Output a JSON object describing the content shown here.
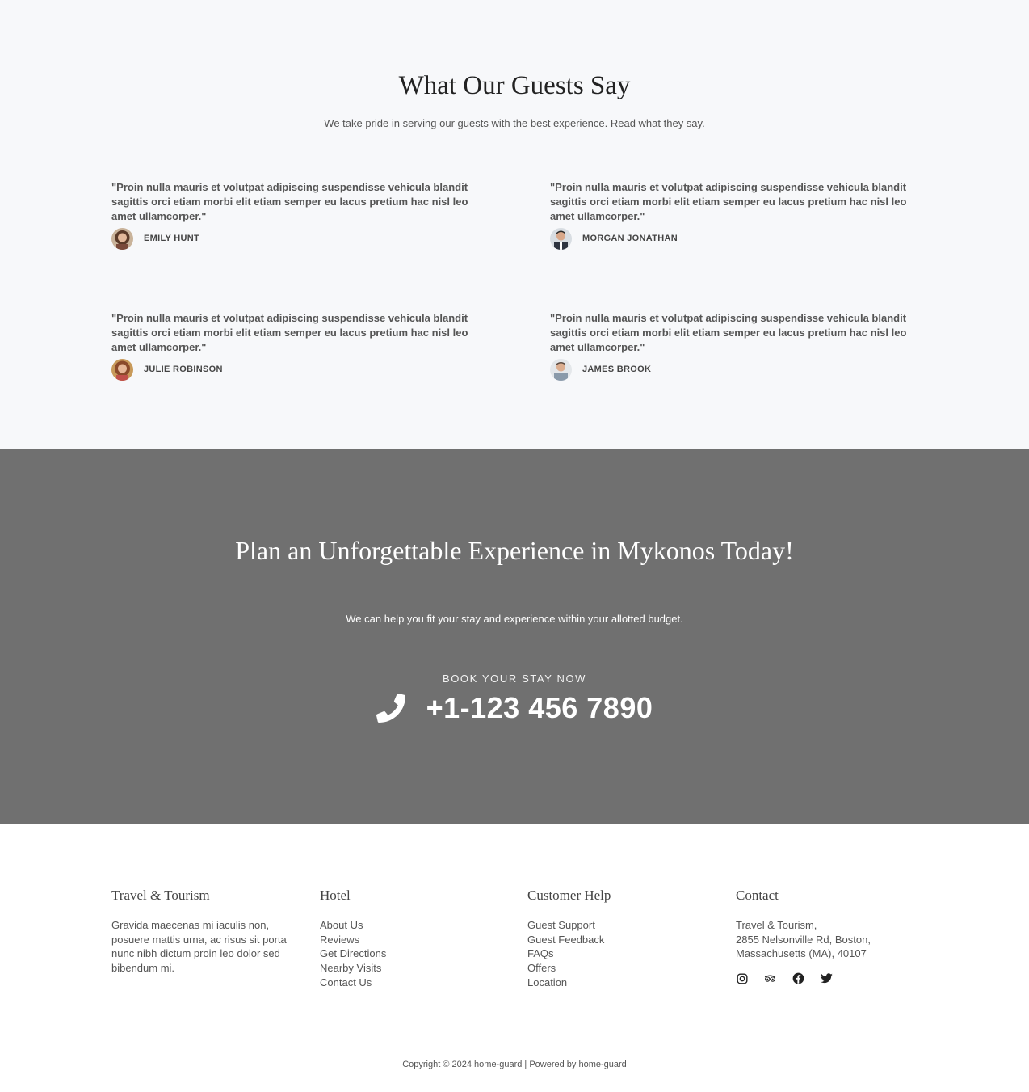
{
  "testimonials": {
    "heading": "What Our Guests Say",
    "subheading": "We take pride in serving our guests with the best experience. Read what they say.",
    "items": [
      {
        "quote": "\"Proin nulla mauris et volutpat adipiscing suspendisse vehicula blandit sagittis orci etiam morbi elit etiam semper eu lacus pretium hac nisl leo amet ullamcorper.\"",
        "name": "EMILY HUNT"
      },
      {
        "quote": "\"Proin nulla mauris et volutpat adipiscing suspendisse vehicula blandit sagittis orci etiam morbi elit etiam semper eu lacus pretium hac nisl leo amet ullamcorper.\"",
        "name": "MORGAN JONATHAN"
      },
      {
        "quote": "\"Proin nulla mauris et volutpat adipiscing suspendisse vehicula blandit sagittis orci etiam morbi elit etiam semper eu lacus pretium hac nisl leo amet ullamcorper.\"",
        "name": "JULIE ROBINSON"
      },
      {
        "quote": "\"Proin nulla mauris et volutpat adipiscing suspendisse vehicula blandit sagittis orci etiam morbi elit etiam semper eu lacus pretium hac nisl leo amet ullamcorper.\"",
        "name": "JAMES BROOK"
      }
    ]
  },
  "cta": {
    "heading": "Plan an Unforgettable Experience in Mykonos Today!",
    "subheading": "We can help you fit your stay and experience within your allotted budget.",
    "book_label": "BOOK YOUR STAY NOW",
    "phone": "+1-123 456 7890",
    "phone_icon": "phone-icon",
    "background_color": "#707070"
  },
  "footer": {
    "about": {
      "title": "Travel & Tourism",
      "text": "Gravida maecenas mi iaculis non, posuere mattis urna, ac risus sit porta nunc nibh dictum proin leo dolor sed bibendum mi."
    },
    "hotel": {
      "title": "Hotel",
      "links": [
        "About Us",
        "Reviews",
        "Get Directions",
        "Nearby Visits",
        "Contact Us"
      ]
    },
    "help": {
      "title": "Customer Help",
      "links": [
        "Guest Support",
        "Guest Feedback",
        "FAQs",
        "Offers",
        "Location"
      ]
    },
    "contact": {
      "title": "Contact",
      "address_line1": "Travel & Tourism,",
      "address_line2": "2855 Nelsonville Rd, Boston,",
      "address_line3": "Massachusetts (MA), 40107",
      "socials": [
        "instagram-icon",
        "tripadvisor-icon",
        "facebook-icon",
        "twitter-icon"
      ]
    },
    "copyright": "Copyright © 2024 home-guard | Powered by home-guard"
  }
}
